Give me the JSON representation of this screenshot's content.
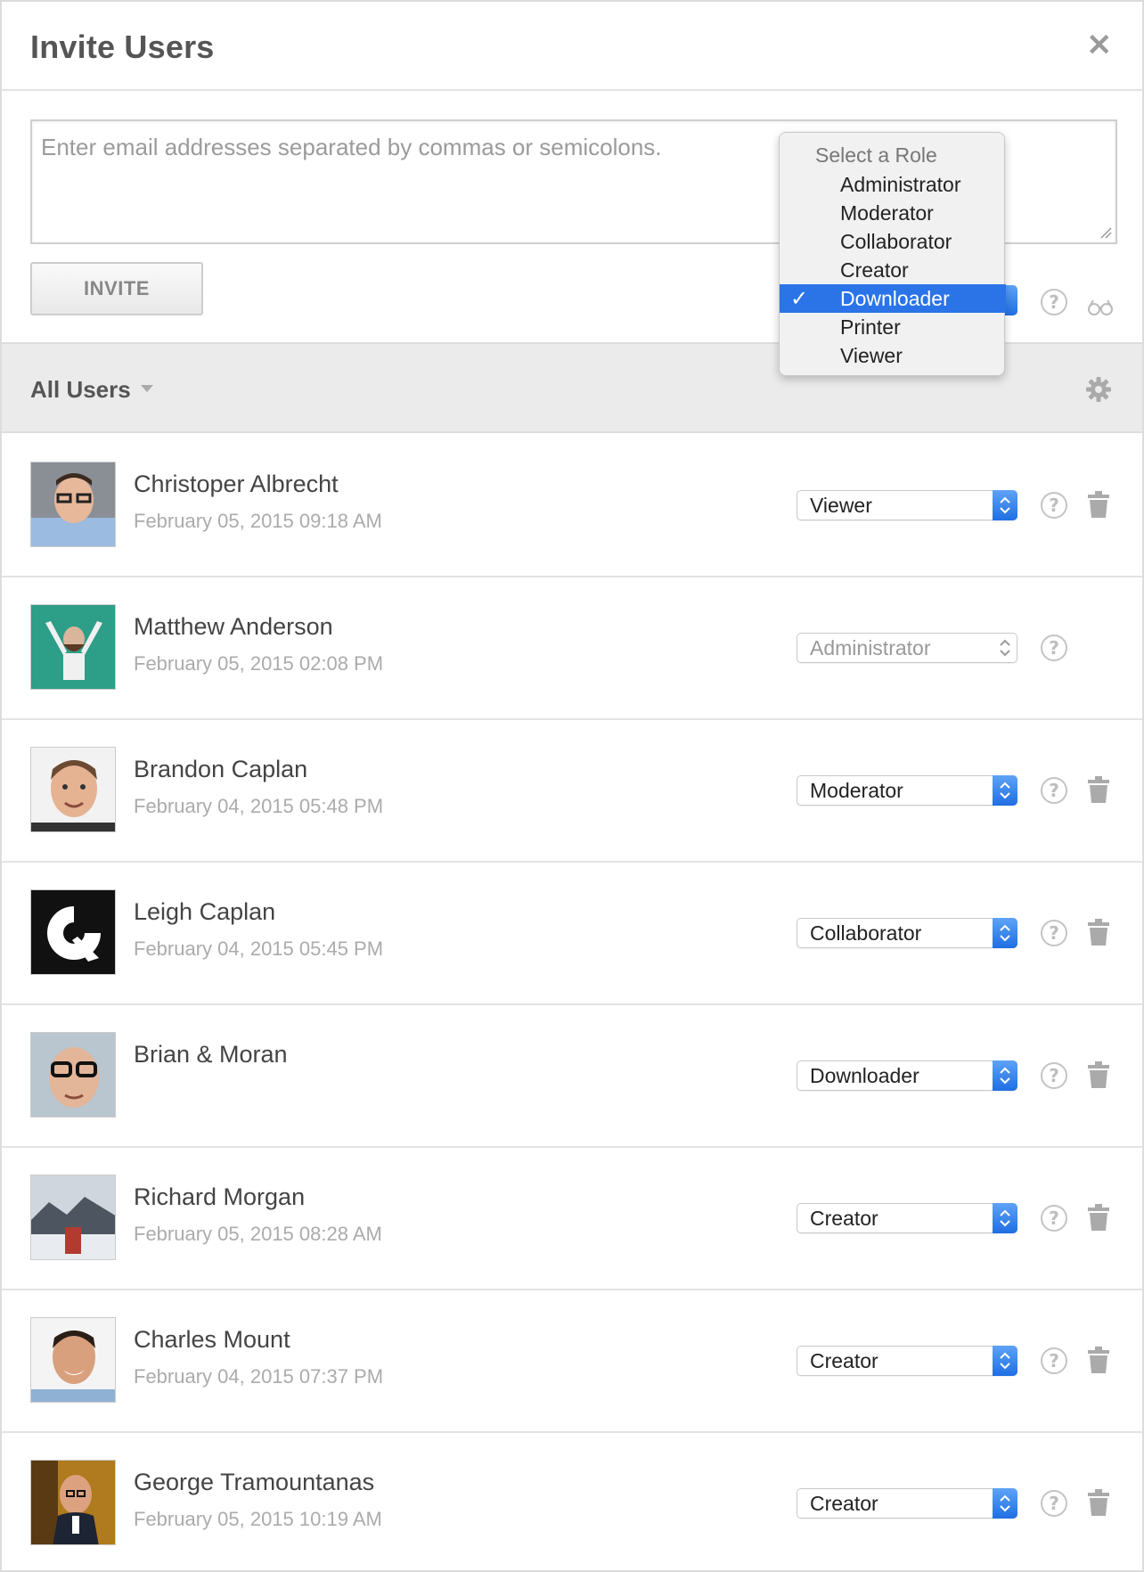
{
  "dialog": {
    "title": "Invite Users"
  },
  "invite": {
    "email_placeholder": "Enter email addresses separated by commas or semicolons.",
    "invite_label": "INVITE"
  },
  "role_menu": {
    "header": "Select a Role",
    "options": [
      "Administrator",
      "Moderator",
      "Collaborator",
      "Creator",
      "Downloader",
      "Printer",
      "Viewer"
    ],
    "selected": "Downloader"
  },
  "users_bar": {
    "filter_label": "All Users"
  },
  "users": [
    {
      "name": "Christoper Albrecht",
      "date": "February 05, 2015 09:18 AM",
      "role": "Viewer"
    },
    {
      "name": "Matthew Anderson",
      "date": "February 05, 2015 02:08 PM",
      "role": "Administrator"
    },
    {
      "name": "Brandon Caplan",
      "date": "February 04, 2015 05:48 PM",
      "role": "Moderator"
    },
    {
      "name": "Leigh Caplan",
      "date": "February 04, 2015 05:45 PM",
      "role": "Collaborator"
    },
    {
      "name": "Brian & Moran",
      "date": "",
      "role": "Downloader"
    },
    {
      "name": "Richard Morgan",
      "date": "February 05, 2015 08:28 AM",
      "role": "Creator"
    },
    {
      "name": "Charles Mount",
      "date": "February 04, 2015 07:37 PM",
      "role": "Creator"
    },
    {
      "name": "George Tramountanas",
      "date": "February 05, 2015 10:19 AM",
      "role": "Creator"
    }
  ],
  "colors": {
    "accent": "#2a74e8",
    "header_bar": "#ebebeb"
  },
  "icons": {
    "close": "close-icon",
    "help": "help-icon",
    "glasses": "glasses-icon",
    "gear": "gear-icon",
    "trash": "trash-icon",
    "checkmark": "checkmark-icon"
  }
}
